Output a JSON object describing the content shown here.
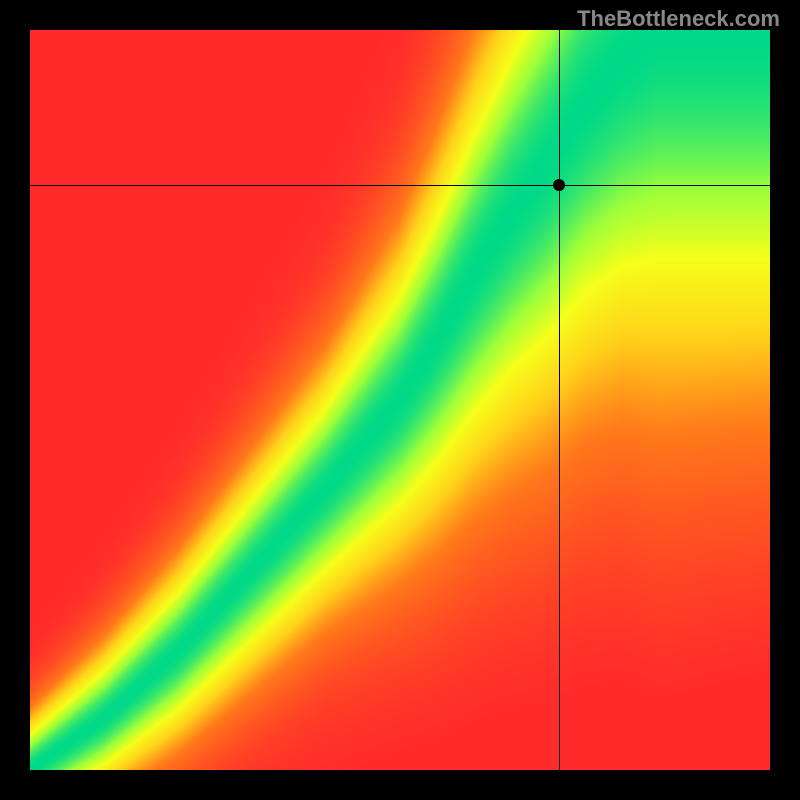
{
  "watermark": "TheBottleneck.com",
  "chart_data": {
    "type": "heatmap",
    "title": "",
    "xlabel": "",
    "ylabel": "",
    "xlim": [
      0,
      1
    ],
    "ylim": [
      0,
      1
    ],
    "crosshair": {
      "x": 0.715,
      "y": 0.79
    },
    "marker": {
      "x": 0.715,
      "y": 0.79
    },
    "ridge": [
      {
        "x": 0.0,
        "y": 0.0
      },
      {
        "x": 0.1,
        "y": 0.07
      },
      {
        "x": 0.2,
        "y": 0.16
      },
      {
        "x": 0.3,
        "y": 0.27
      },
      {
        "x": 0.4,
        "y": 0.38
      },
      {
        "x": 0.5,
        "y": 0.5
      },
      {
        "x": 0.55,
        "y": 0.58
      },
      {
        "x": 0.6,
        "y": 0.67
      },
      {
        "x": 0.65,
        "y": 0.75
      },
      {
        "x": 0.7,
        "y": 0.82
      },
      {
        "x": 0.75,
        "y": 0.9
      },
      {
        "x": 0.8,
        "y": 0.96
      },
      {
        "x": 0.85,
        "y": 1.0
      }
    ],
    "ridge_width": [
      {
        "x": 0.0,
        "w": 0.01
      },
      {
        "x": 0.1,
        "w": 0.015
      },
      {
        "x": 0.2,
        "w": 0.02
      },
      {
        "x": 0.3,
        "w": 0.025
      },
      {
        "x": 0.4,
        "w": 0.03
      },
      {
        "x": 0.5,
        "w": 0.04
      },
      {
        "x": 0.6,
        "w": 0.055
      },
      {
        "x": 0.7,
        "w": 0.07
      },
      {
        "x": 0.8,
        "w": 0.085
      },
      {
        "x": 0.85,
        "w": 0.095
      }
    ],
    "color_stops": [
      {
        "t": 0.0,
        "color": "#ff2a2a"
      },
      {
        "t": 0.35,
        "color": "#ff7a1a"
      },
      {
        "t": 0.55,
        "color": "#ffd21a"
      },
      {
        "t": 0.72,
        "color": "#f6ff1a"
      },
      {
        "t": 0.85,
        "color": "#9dff3a"
      },
      {
        "t": 1.0,
        "color": "#00d987"
      }
    ]
  }
}
